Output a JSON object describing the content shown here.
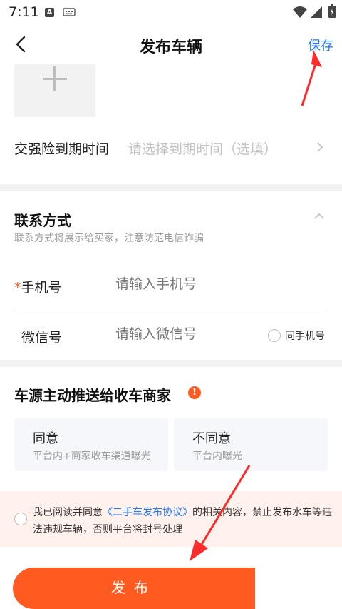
{
  "status_bar": {
    "time": "7:11",
    "notif_letter": "A"
  },
  "nav": {
    "title": "发布车辆",
    "save_label": "保存"
  },
  "insurance": {
    "label": "交强险到期时间",
    "placeholder": "请选择到期时间（选填）"
  },
  "contact": {
    "title": "联系方式",
    "subtitle": "联系方式将展示给买家，注意防范电信诈骗",
    "phone": {
      "required_mark": "*",
      "label": "手机号",
      "placeholder": "请输入手机号"
    },
    "wechat": {
      "label": "微信号",
      "placeholder": "请输入微信号",
      "same_as_phone": "同手机号"
    }
  },
  "push": {
    "title": "车源主动推送给收车商家",
    "warn_icon_text": "!",
    "options": [
      {
        "title": "同意",
        "desc": "平台内+商家收车渠道曝光"
      },
      {
        "title": "不同意",
        "desc": "平台内曝光"
      }
    ]
  },
  "agreement": {
    "prefix": "我已阅读并同意",
    "link": "《二手车发布协议》",
    "suffix": "的相关内容，禁止发布水车等违法违规车辆，否则平台将封号处理"
  },
  "publish_label": "发布",
  "colors": {
    "accent": "#ff5a1f",
    "link": "#1e78ff",
    "annotation_arrow": "#ff2a2a"
  }
}
